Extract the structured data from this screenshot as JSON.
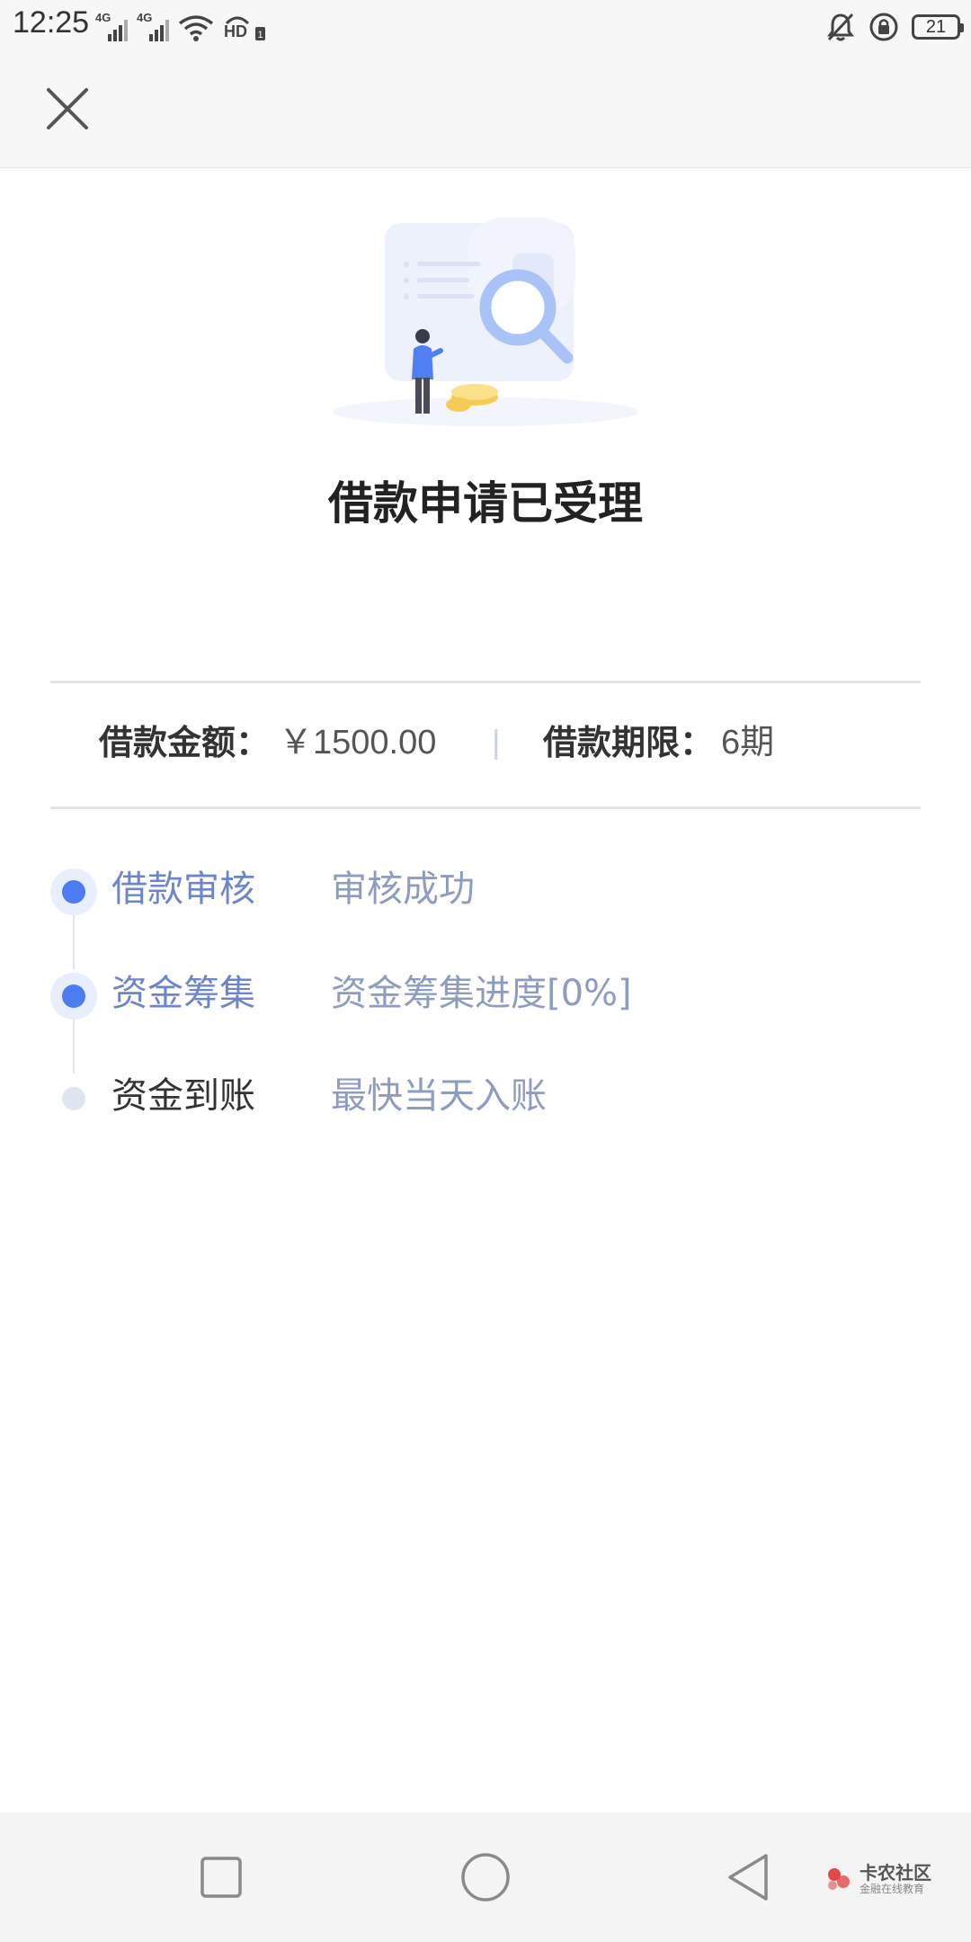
{
  "status_bar": {
    "time": "12:25",
    "network_1": "4G",
    "network_2": "4G",
    "hd_label": "HD",
    "battery_level": "21",
    "icons": [
      "signal-icon",
      "signal-icon",
      "wifi-icon",
      "hd-volte-icon",
      "mute-bell-icon",
      "rotation-lock-icon",
      "battery-icon"
    ]
  },
  "header": {
    "close_icon": "close-icon"
  },
  "page": {
    "title": "借款申请已受理"
  },
  "summary": {
    "amount_label": "借款金额：",
    "amount_value": "￥1500.00",
    "separator": "|",
    "term_label": "借款期限：",
    "term_value": "6期"
  },
  "steps": [
    {
      "name": "借款审核",
      "status": "审核成功",
      "state": "active"
    },
    {
      "name": "资金筹集",
      "status": "资金筹集进度[0%]",
      "state": "active"
    },
    {
      "name": "资金到账",
      "status": "最快当天入账",
      "state": "pending"
    }
  ],
  "nav_bar": {
    "buttons": [
      "recent-apps-icon",
      "home-icon",
      "back-icon"
    ]
  },
  "watermark": {
    "main": "卡农社区",
    "sub": "金融在线教育"
  },
  "colors": {
    "accent": "#4d7cf0",
    "step_active_text": "#6c86c9",
    "status_text": "#8d9cbf",
    "divider": "#dce5ec"
  }
}
